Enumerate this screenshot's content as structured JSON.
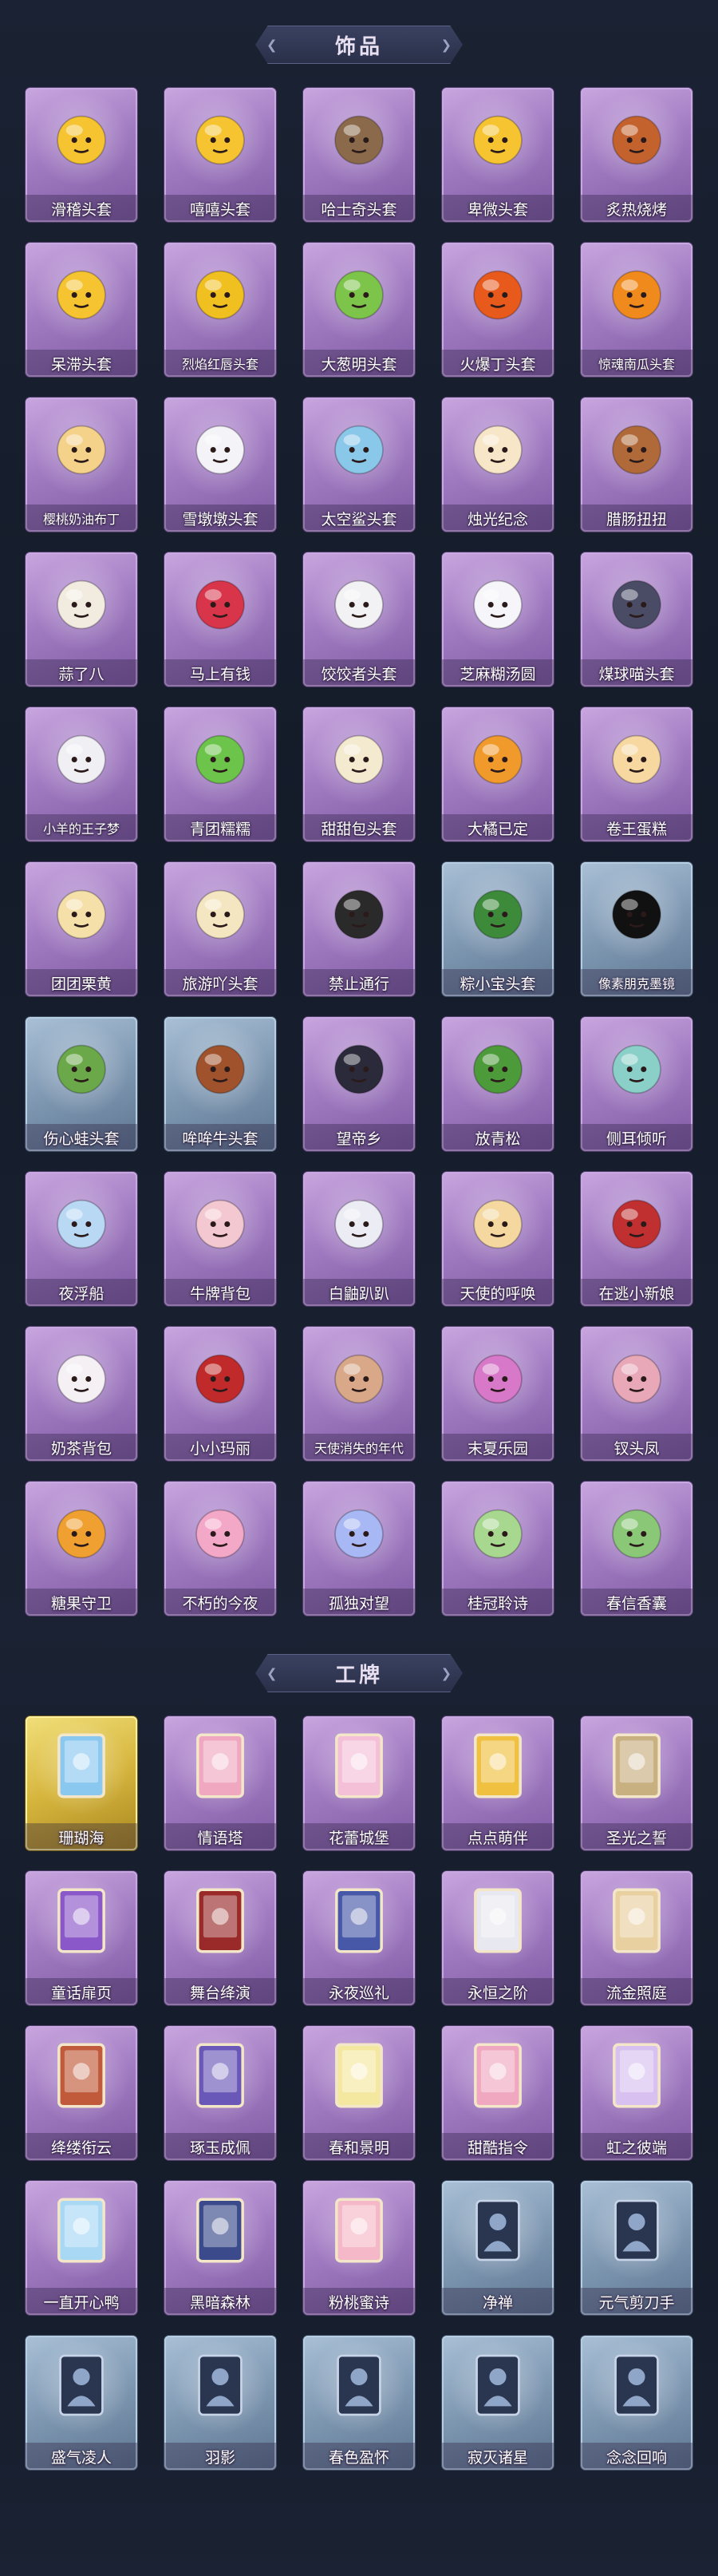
{
  "sections": [
    {
      "title": "饰品",
      "items": [
        {
          "label": "滑稽头套",
          "icon": "smiley-face-icon",
          "color": "#f5c430",
          "rarity": "purple"
        },
        {
          "label": "嘻嘻头套",
          "icon": "grin-face-icon",
          "color": "#f5c430",
          "rarity": "purple"
        },
        {
          "label": "哈士奇头套",
          "icon": "husky-dog-icon",
          "color": "#8a6a4a",
          "rarity": "purple"
        },
        {
          "label": "卑微头套",
          "icon": "humble-face-icon",
          "color": "#f5c430",
          "rarity": "purple"
        },
        {
          "label": "炙热烧烤",
          "icon": "grill-icon",
          "color": "#c4622d",
          "rarity": "purple"
        },
        {
          "label": "呆滞头套",
          "icon": "dazed-face-icon",
          "color": "#f5c430",
          "rarity": "purple"
        },
        {
          "label": "烈焰红唇头套",
          "icon": "pikachu-sunglasses-icon",
          "color": "#f0c020",
          "rarity": "purple"
        },
        {
          "label": "大葱明头套",
          "icon": "scallion-icon",
          "color": "#7cc44a",
          "rarity": "purple"
        },
        {
          "label": "火爆丁头套",
          "icon": "fire-spirit-icon",
          "color": "#e85a1c",
          "rarity": "purple"
        },
        {
          "label": "惊魂南瓜头套",
          "icon": "pumpkin-icon",
          "color": "#f08a1c",
          "rarity": "purple"
        },
        {
          "label": "樱桃奶油布丁",
          "icon": "pudding-icon",
          "color": "#f5d28a",
          "rarity": "purple"
        },
        {
          "label": "雪墩墩头套",
          "icon": "snowman-icon",
          "color": "#f4f4f8",
          "rarity": "purple"
        },
        {
          "label": "太空鲨头套",
          "icon": "shark-icon",
          "color": "#8ac8ea",
          "rarity": "purple"
        },
        {
          "label": "烛光纪念",
          "icon": "candle-icon",
          "color": "#f7e6c8",
          "rarity": "purple"
        },
        {
          "label": "腊肠扭扭",
          "icon": "sausage-dog-icon",
          "color": "#b06a3a",
          "rarity": "purple"
        },
        {
          "label": "蒜了八",
          "icon": "garlic-icon",
          "color": "#f2ece0",
          "rarity": "purple"
        },
        {
          "label": "马上有钱",
          "icon": "red-horse-icon",
          "color": "#d8344a",
          "rarity": "purple"
        },
        {
          "label": "饺饺者头套",
          "icon": "dumpling-icon",
          "color": "#f2f2f4",
          "rarity": "purple"
        },
        {
          "label": "芝麻糊汤圆",
          "icon": "tangyuan-icon",
          "color": "#f6f6fa",
          "rarity": "purple"
        },
        {
          "label": "煤球喵头套",
          "icon": "black-cat-icon",
          "color": "#4a4c66",
          "rarity": "purple"
        },
        {
          "label": "小羊的王子梦",
          "icon": "sheep-icon",
          "color": "#f0f0f4",
          "rarity": "purple"
        },
        {
          "label": "青团糯糯",
          "icon": "qingtuan-icon",
          "color": "#6cc44a",
          "rarity": "purple"
        },
        {
          "label": "甜甜包头套",
          "icon": "bun-icon",
          "color": "#f4ead0",
          "rarity": "purple"
        },
        {
          "label": "大橘已定",
          "icon": "orange-slice-icon",
          "color": "#f09a2c",
          "rarity": "purple"
        },
        {
          "label": "卷王蛋糕",
          "icon": "cake-roll-icon",
          "color": "#f6d8a0",
          "rarity": "purple"
        },
        {
          "label": "团团栗黄",
          "icon": "chestnut-icon",
          "color": "#f4e0a8",
          "rarity": "purple"
        },
        {
          "label": "旅游吖头套",
          "icon": "duck-hat-icon",
          "color": "#f4e6c0",
          "rarity": "purple"
        },
        {
          "label": "禁止通行",
          "icon": "traffic-cone-icon",
          "color": "#2a2a2a",
          "rarity": "purple"
        },
        {
          "label": "粽小宝头套",
          "icon": "zongzi-icon",
          "color": "#3c8a3a",
          "rarity": "blue"
        },
        {
          "label": "像素朋克墨镜",
          "icon": "pixel-sunglasses-icon",
          "color": "#111111",
          "rarity": "blue"
        },
        {
          "label": "伤心蛙头套",
          "icon": "sad-frog-icon",
          "color": "#6aa84a",
          "rarity": "blue"
        },
        {
          "label": "哞哞牛头套",
          "icon": "cow-head-icon",
          "color": "#a0522d",
          "rarity": "blue"
        },
        {
          "label": "望帝乡",
          "icon": "figure-doll-icon",
          "color": "#2a2a3a",
          "rarity": "purple"
        },
        {
          "label": "放青松",
          "icon": "bonsai-pine-icon",
          "color": "#4c9a3a",
          "rarity": "purple"
        },
        {
          "label": "侧耳倾听",
          "icon": "flower-headband-icon",
          "color": "#8ad0c8",
          "rarity": "purple"
        },
        {
          "label": "夜浮船",
          "icon": "ice-crystal-icon",
          "color": "#b8d8f4",
          "rarity": "purple"
        },
        {
          "label": "牛牌背包",
          "icon": "cake-backpack-icon",
          "color": "#f4c8d0",
          "rarity": "purple"
        },
        {
          "label": "白鼬趴趴",
          "icon": "ferret-icon",
          "color": "#ececf4",
          "rarity": "purple"
        },
        {
          "label": "天使的呼唤",
          "icon": "angel-doll-icon",
          "color": "#f4d8a0",
          "rarity": "purple"
        },
        {
          "label": "在逃小新娘",
          "icon": "bride-doll-icon",
          "color": "#c03030",
          "rarity": "purple"
        },
        {
          "label": "奶茶背包",
          "icon": "milk-tea-bag-icon",
          "color": "#f4f0f4",
          "rarity": "purple"
        },
        {
          "label": "小小玛丽",
          "icon": "mary-doll-icon",
          "color": "#c02a2a",
          "rarity": "purple"
        },
        {
          "label": "天使消失的年代",
          "icon": "portrait-doll-icon",
          "color": "#d8a888",
          "rarity": "purple"
        },
        {
          "label": "末夏乐园",
          "icon": "twin-tail-doll-icon",
          "color": "#d878c8",
          "rarity": "purple"
        },
        {
          "label": "钗头凤",
          "icon": "phoenix-doll-icon",
          "color": "#e8a8b8",
          "rarity": "purple"
        },
        {
          "label": "糖果守卫",
          "icon": "candy-guard-icon",
          "color": "#f0a030",
          "rarity": "purple"
        },
        {
          "label": "不朽的今夜",
          "icon": "pink-charm-icon",
          "color": "#f4a8c8",
          "rarity": "purple"
        },
        {
          "label": "孤独对望",
          "icon": "blue-doll-charm-icon",
          "color": "#a8b8f4",
          "rarity": "purple"
        },
        {
          "label": "桂冠聆诗",
          "icon": "laurel-doll-icon",
          "color": "#a8d890",
          "rarity": "purple"
        },
        {
          "label": "春信香囊",
          "icon": "sachet-icon",
          "color": "#8ac878",
          "rarity": "purple"
        }
      ]
    },
    {
      "title": "工牌",
      "items": [
        {
          "label": "珊瑚海",
          "icon": "coral-card-icon",
          "color": "#8ac8f0",
          "rarity": "gold"
        },
        {
          "label": "情语塔",
          "icon": "tower-card-icon",
          "color": "#f0a8c0",
          "rarity": "purple"
        },
        {
          "label": "花蕾城堡",
          "icon": "castle-card-icon",
          "color": "#f4c0d8",
          "rarity": "purple"
        },
        {
          "label": "点点萌伴",
          "icon": "sunny-card-icon",
          "color": "#f0c040",
          "rarity": "purple"
        },
        {
          "label": "圣光之誓",
          "icon": "holy-card-icon",
          "color": "#c8b080",
          "rarity": "purple"
        },
        {
          "label": "童话扉页",
          "icon": "fairytale-card-icon",
          "color": "#8a58c8",
          "rarity": "purple"
        },
        {
          "label": "舞台绛演",
          "icon": "stage-card-icon",
          "color": "#9a2a2a",
          "rarity": "purple"
        },
        {
          "label": "永夜巡礼",
          "icon": "night-card-icon",
          "color": "#4858a8",
          "rarity": "purple"
        },
        {
          "label": "永恒之阶",
          "icon": "stair-card-icon",
          "color": "#e8e8f0",
          "rarity": "purple"
        },
        {
          "label": "流金照庭",
          "icon": "gold-frame-card-icon",
          "color": "#e8d0a0",
          "rarity": "purple"
        },
        {
          "label": "绛缕衔云",
          "icon": "crimson-card-icon",
          "color": "#c05a3a",
          "rarity": "purple"
        },
        {
          "label": "琢玉成佩",
          "icon": "jade-card-icon",
          "color": "#6a58b8",
          "rarity": "purple"
        },
        {
          "label": "春和景明",
          "icon": "spring-card-icon",
          "color": "#f4e8a0",
          "rarity": "purple"
        },
        {
          "label": "甜酷指令",
          "icon": "monster-card-icon",
          "color": "#f0a8c0",
          "rarity": "purple"
        },
        {
          "label": "虹之彼端",
          "icon": "rainbow-card-icon",
          "color": "#d8c0f0",
          "rarity": "purple"
        },
        {
          "label": "一直开心鸭",
          "icon": "duck-card-icon",
          "color": "#a8d8f4",
          "rarity": "purple"
        },
        {
          "label": "黑暗森林",
          "icon": "dark-forest-card-icon",
          "color": "#3a4a8a",
          "rarity": "purple"
        },
        {
          "label": "粉桃蜜诗",
          "icon": "peach-card-icon",
          "color": "#f4b8c8",
          "rarity": "purple"
        },
        {
          "label": "净禅",
          "icon": "silhouette-card-icon",
          "color": "#6a7ea0",
          "rarity": "blue"
        },
        {
          "label": "元气剪刀手",
          "icon": "silhouette-card-icon",
          "color": "#6a7ea0",
          "rarity": "blue"
        },
        {
          "label": "盛气凌人",
          "icon": "silhouette-card-icon",
          "color": "#6a7ea0",
          "rarity": "blue"
        },
        {
          "label": "羽影",
          "icon": "silhouette-card-icon",
          "color": "#6a7ea0",
          "rarity": "blue"
        },
        {
          "label": "春色盈怀",
          "icon": "silhouette-card-icon",
          "color": "#6a7ea0",
          "rarity": "blue"
        },
        {
          "label": "寂灭诸星",
          "icon": "silhouette-card-icon",
          "color": "#6a7ea0",
          "rarity": "blue"
        },
        {
          "label": "念念回响",
          "icon": "silhouette-card-icon",
          "color": "#6a7ea0",
          "rarity": "blue"
        }
      ]
    }
  ]
}
